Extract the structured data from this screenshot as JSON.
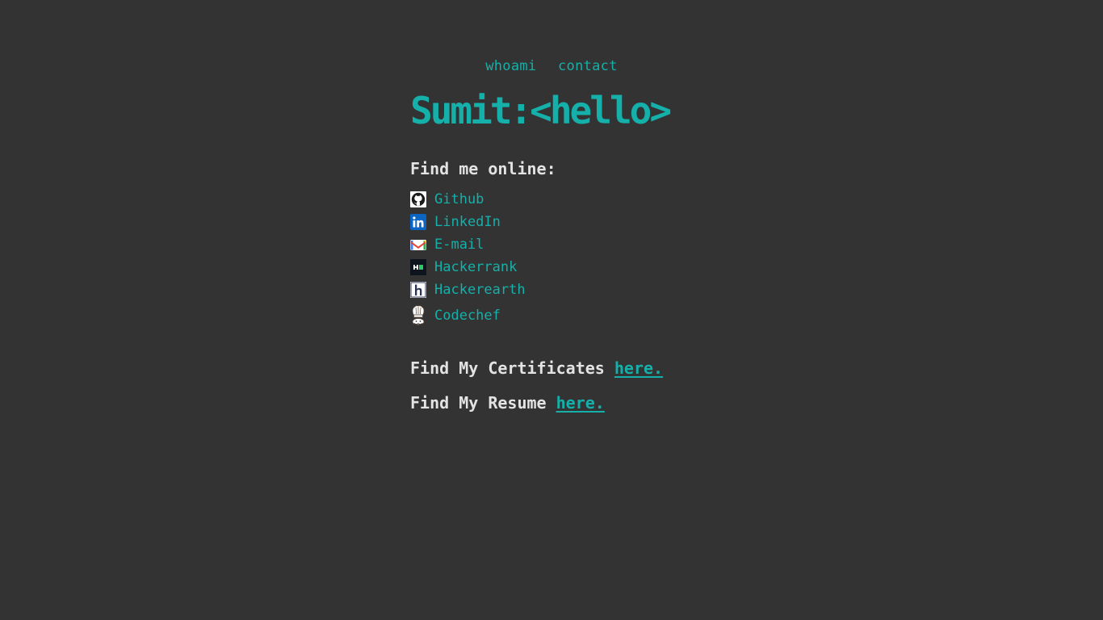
{
  "nav": {
    "items": [
      {
        "label": "whoami"
      },
      {
        "label": "contact"
      }
    ]
  },
  "title": "Sumit:<hello>",
  "find_online": {
    "heading": "Find me online:",
    "links": [
      {
        "label": "Github",
        "icon": "github-icon"
      },
      {
        "label": "LinkedIn",
        "icon": "linkedin-icon"
      },
      {
        "label": "E-mail",
        "icon": "gmail-icon"
      },
      {
        "label": "Hackerrank",
        "icon": "hackerrank-icon"
      },
      {
        "label": "Hackerearth",
        "icon": "hackerearth-icon"
      },
      {
        "label": "Codechef",
        "icon": "codechef-icon"
      }
    ]
  },
  "certificates": {
    "text": "Find My Certificates ",
    "link": "here."
  },
  "resume": {
    "text": "Find My Resume ",
    "link": "here."
  },
  "colors": {
    "background": "#333333",
    "accent": "#14b0a9",
    "text": "#e3e3e3"
  }
}
